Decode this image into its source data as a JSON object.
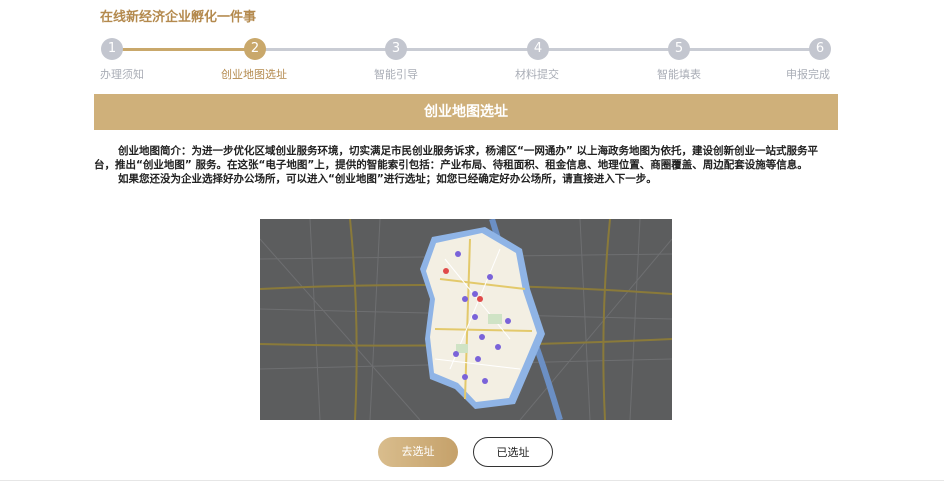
{
  "page_title": "在线新经济企业孵化一件事",
  "steps": [
    {
      "number": "1",
      "label": "办理须知"
    },
    {
      "number": "2",
      "label": "创业地图选址"
    },
    {
      "number": "3",
      "label": "智能引导"
    },
    {
      "number": "4",
      "label": "材料提交"
    },
    {
      "number": "5",
      "label": "智能填表"
    },
    {
      "number": "6",
      "label": "申报完成"
    }
  ],
  "active_step": 2,
  "section_title": "创业地图选址",
  "intro": {
    "paragraph1": "创业地图简介：为进一步优化区域创业服务环境，切实满足市民创业服务诉求，杨浦区“一网通办” 以上海政务地图为依托，建设创新创业一站式服务平台，推出“创业地图” 服务。在这张“电子地图”上，提供的智能索引包括：产业布局、待租面积、租金信息、地理位置、商圈覆盖、周边配套设施等信息。",
    "paragraph2": "如果您还没为企业选择好办公场所，可以进入“创业地图”进行选址；如您已经确定好办公场所，请直接进入下一步。"
  },
  "buttons": {
    "select_site": "去选址",
    "already_selected": "已选址"
  },
  "colors": {
    "accent_gold": "#c9a86b",
    "title_gold": "#b48a4e",
    "inactive_step": "#c3c6cf",
    "river": "#8fb4e6"
  }
}
